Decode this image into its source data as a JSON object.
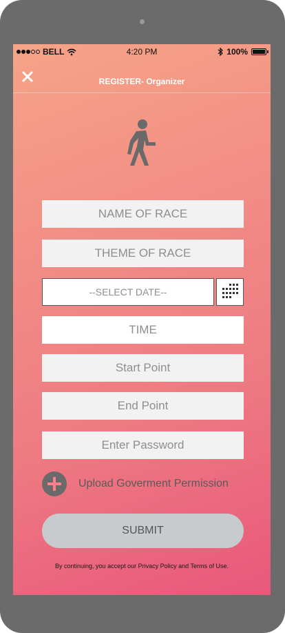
{
  "status_bar": {
    "carrier": "BELL",
    "time": "4:20 PM",
    "battery": "100%"
  },
  "header": {
    "title": "REGISTER- Organizer",
    "close_icon": "close-icon"
  },
  "hero_icon": "walking-person-icon",
  "form": {
    "race_name_placeholder": "NAME OF RACE",
    "race_theme_placeholder": "THEME OF RACE",
    "date_placeholder": "--SELECT DATE--",
    "calendar_icon": "calendar-icon",
    "time_placeholder": "TIME",
    "start_point_placeholder": "Start Point",
    "end_point_placeholder": "End Point",
    "password_placeholder": "Enter Password"
  },
  "upload": {
    "label": "Upload Goverment Permission",
    "icon": "plus-circle-icon"
  },
  "submit_label": "SUBMIT",
  "footer_text": "By continuing, you accept our Privacy Policy and Terms of Use.",
  "colors": {
    "device_frame": "#6b6b6b",
    "gradient_start": "#f6a487",
    "gradient_end": "#e8587a",
    "field_bg": "#f2f2f2",
    "placeholder_text": "#8e8e8e",
    "submit_bg": "#c8cbce"
  }
}
